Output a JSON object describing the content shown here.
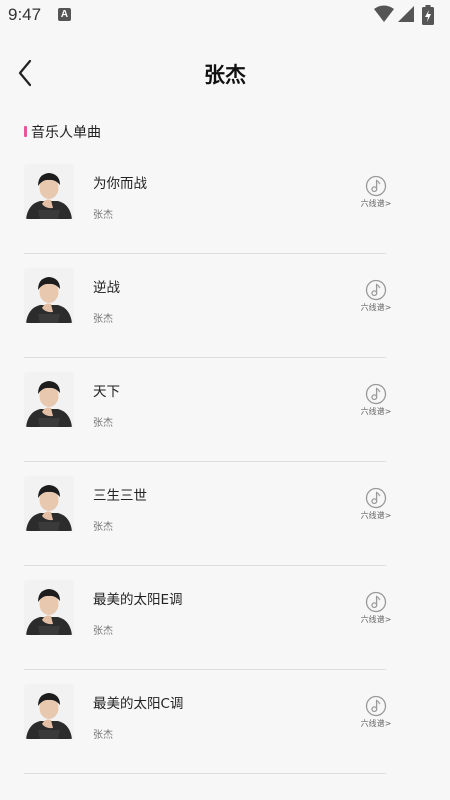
{
  "status_bar": {
    "time": "9:47",
    "notification_badge": "A",
    "icons": [
      "wifi-icon",
      "signal-icon",
      "battery-charging-icon"
    ]
  },
  "header": {
    "title": "张杰",
    "back_icon": "chevron-left-icon"
  },
  "section": {
    "title": "音乐人单曲",
    "accent_color": "#e8559b"
  },
  "songs": [
    {
      "title": "为你而战",
      "artist": "张杰",
      "tab_label": "六线谱>"
    },
    {
      "title": "逆战",
      "artist": "张杰",
      "tab_label": "六线谱>"
    },
    {
      "title": "天下",
      "artist": "张杰",
      "tab_label": "六线谱>"
    },
    {
      "title": "三生三世",
      "artist": "张杰",
      "tab_label": "六线谱>"
    },
    {
      "title": "最美的太阳E调",
      "artist": "张杰",
      "tab_label": "六线谱>"
    },
    {
      "title": "最美的太阳C调",
      "artist": "张杰",
      "tab_label": "六线谱>"
    }
  ]
}
